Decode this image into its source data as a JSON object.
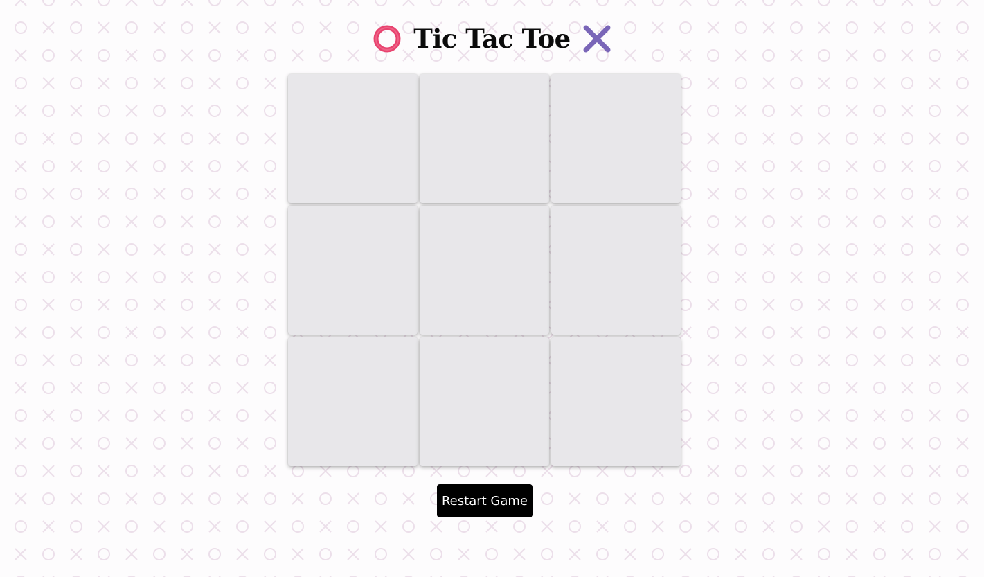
{
  "header": {
    "title": "Tic Tac Toe",
    "left_icon": "o-mark-icon",
    "right_icon": "x-mark-icon"
  },
  "board": {
    "cells": [
      "",
      "",
      "",
      "",
      "",
      "",
      "",
      "",
      ""
    ]
  },
  "restart_button": {
    "label": "Restart Game"
  },
  "colors": {
    "o_mark": "#e8436f",
    "x_mark": "#7a66b8",
    "cell_bg": "#e8e7ea",
    "button_bg": "#000000",
    "background_pattern": "#ecdfea"
  }
}
